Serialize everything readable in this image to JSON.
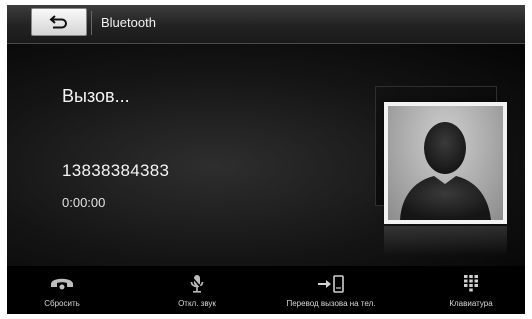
{
  "header": {
    "title": "Bluetooth",
    "back_icon": "back-arrow-icon"
  },
  "call": {
    "status": "Вызов...",
    "number": "13838384383",
    "duration": "0:00:00",
    "avatar_icon": "contact-silhouette-icon"
  },
  "bottom_bar": {
    "items": [
      {
        "label": "Сбросить",
        "icon": "hang-up-icon"
      },
      {
        "label": "Откл. звук",
        "icon": "mute-microphone-icon"
      },
      {
        "label": "Перевод вызова на тел.",
        "icon": "transfer-to-phone-icon"
      },
      {
        "label": "Клавиатура",
        "icon": "keypad-icon"
      }
    ]
  },
  "colors": {
    "background": "#000000",
    "text": "#f4f4f4",
    "header_gradient_top": "#3d3d3d"
  }
}
